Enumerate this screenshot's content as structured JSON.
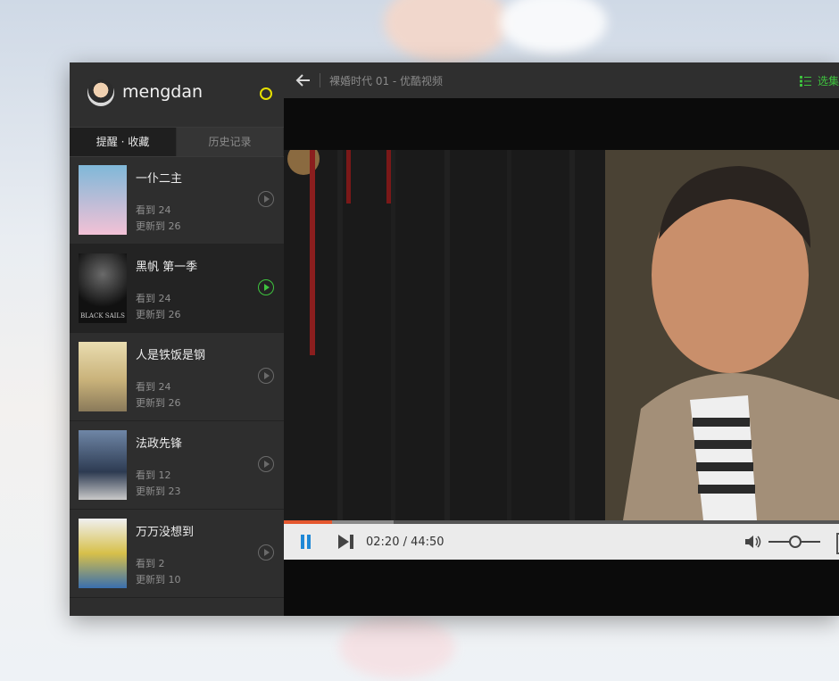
{
  "user": {
    "name": "mengdan"
  },
  "tabs": [
    {
      "label": "提醒 · 收藏",
      "active": true
    },
    {
      "label": "历史记录",
      "active": false
    }
  ],
  "shows": [
    {
      "title": "一仆二主",
      "watched": "看到 24",
      "updated": "更新到 26",
      "poster_colors": [
        "#7fb8d8",
        "#f3c1d6"
      ]
    },
    {
      "title": "黑帆 第一季",
      "watched": "看到 24",
      "updated": "更新到 26",
      "poster_colors": [
        "#111111",
        "#6a6a6a"
      ],
      "poster_text": "BLACK SAILS"
    },
    {
      "title": "人是铁饭是钢",
      "watched": "看到 24",
      "updated": "更新到 26",
      "poster_colors": [
        "#e4d8a0",
        "#b03a2e"
      ]
    },
    {
      "title": "法政先锋",
      "watched": "看到 12",
      "updated": "更新到 23",
      "poster_colors": [
        "#3b4d6a",
        "#c9c9c9"
      ]
    },
    {
      "title": "万万没想到",
      "watched": "看到 2",
      "updated": "更新到 10",
      "poster_colors": [
        "#d7c04a",
        "#3a6fae"
      ]
    }
  ],
  "player": {
    "title": "裸婚时代 01   - 优酷视频",
    "episodes_label": "选集",
    "time": "02:20 / 44:50",
    "progress_played": 0.087,
    "progress_buffered": 0.198,
    "volume": 0.5
  },
  "colors": {
    "accent_green": "#3ec43e",
    "accent_blue": "#1e88d6",
    "progress": "#e4572e",
    "status_ring": "#e6e000"
  }
}
